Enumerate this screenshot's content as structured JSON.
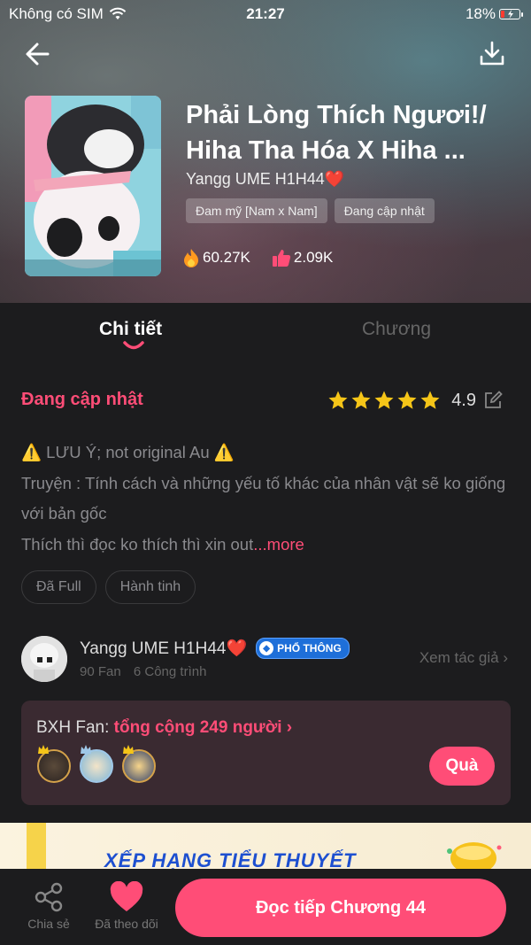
{
  "status_bar": {
    "carrier": "Không có SIM",
    "time": "21:27",
    "battery": "18%",
    "battery_level": 0.18
  },
  "header": {
    "back_icon": "arrow-left-icon",
    "download_icon": "download-icon"
  },
  "book": {
    "title": "Phải Lòng Thích Ngươi!/ Hiha Tha Hóa X Hiha ...",
    "author": "Yangg UME H1H44❤️",
    "tags": [
      "Đam mỹ [Nam x Nam]",
      "Đang cập nhật"
    ],
    "views": "60.27K",
    "likes": "2.09K"
  },
  "tabs": [
    {
      "label": "Chi tiết",
      "active": true
    },
    {
      "label": "Chương",
      "active": false
    }
  ],
  "detail": {
    "status": "Đang cập nhật",
    "rating": "4.9",
    "stars": 5,
    "description_warning": "⚠️ LƯU Ý; not original Au ⚠️",
    "description_line1": "Truyện : Tính cách và những yếu tố khác của nhân vật sẽ ko giống với bản gốc",
    "description_line2": "Thích thì đọc ko thích thì xin out",
    "more": "...more",
    "chips": [
      "Đã Full",
      "Hành tinh"
    ]
  },
  "author_card": {
    "name": "Yangg UME H1H44❤️",
    "badge": "PHỔ THÔNG",
    "fans": "90 Fan",
    "works": "6 Công trình",
    "view_author": "Xem tác giả ›"
  },
  "fan_rank": {
    "label": "BXH Fan: ",
    "total": "tổng cộng 249 người ›",
    "gift_button": "Quà"
  },
  "banner": {
    "text": "XẾP HẠNG TIỂU THUYẾT"
  },
  "bottom_bar": {
    "share": "Chia sẻ",
    "follow": "Đã theo dõi",
    "read": "Đọc tiếp Chương 44"
  },
  "colors": {
    "accent": "#ff4d77",
    "background": "#1c1c1e",
    "star": "#f5c518",
    "badge": "#1e6fd9"
  }
}
